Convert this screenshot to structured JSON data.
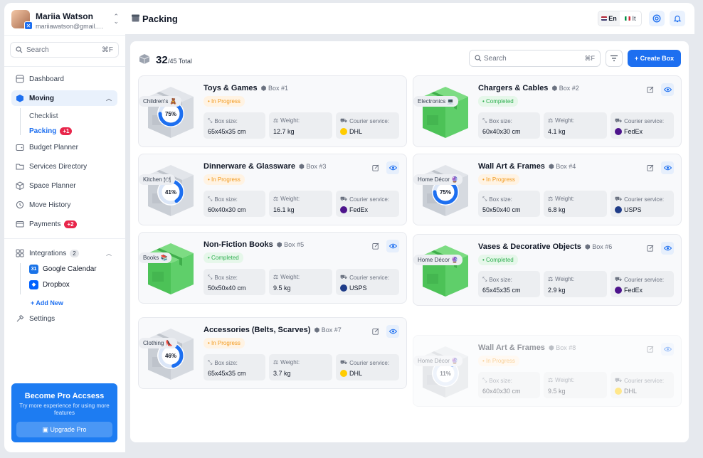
{
  "user": {
    "name": "Mariia Watson",
    "email": "mariiawatson@gmail.c..."
  },
  "sidebar": {
    "search_placeholder": "Search",
    "search_shortcut": "⌘F",
    "nav": [
      {
        "label": "Dashboard"
      },
      {
        "label": "Moving"
      },
      {
        "label": "Budget Planner"
      },
      {
        "label": "Services Directory"
      },
      {
        "label": "Space Planner"
      },
      {
        "label": "Move History"
      },
      {
        "label": "Payments",
        "badge": "+2"
      }
    ],
    "moving_sub": [
      {
        "label": "Checklist"
      },
      {
        "label": "Packing",
        "badge": "+1"
      }
    ],
    "integrations": {
      "label": "Integrations",
      "count": "2",
      "items": [
        {
          "label": "Google Calendar",
          "logo": "31",
          "color": "#1a73e8"
        },
        {
          "label": "Dropbox",
          "logo": "◆",
          "color": "#0061ff"
        }
      ],
      "add_new": "+ Add New"
    },
    "settings": "Settings",
    "pro": {
      "title": "Become Pro Accsess",
      "subtitle": "Try more experience for using more features",
      "button": "Upgrade Pro"
    }
  },
  "header": {
    "title": "Packing",
    "lang_en": "En",
    "lang_it": "It"
  },
  "toolbar": {
    "count": "32",
    "total": "/45 Total",
    "search_placeholder": "Search",
    "search_shortcut": "⌘F",
    "create_label": "+ Create Box"
  },
  "labels": {
    "box_size": "Box size:",
    "weight": "Weight:",
    "courier": "Courier service:"
  },
  "colors": {
    "accent": "#1d6ff0",
    "progress": "#f29a1e",
    "completed": "#2eaf4f",
    "box_green": "#5fcf6a",
    "box_gray": "#cfd3d9"
  },
  "boxes": [
    {
      "title": "Toys & Games",
      "num": "Box #1",
      "status": "• In Progress",
      "state": "progress",
      "category": "Children's 🧸",
      "percent": 75,
      "percent_label": "75%",
      "size": "65x45x35 cm",
      "weight": "12.7 kg",
      "courier": "DHL",
      "courier_color": "#ffcc00"
    },
    {
      "title": "Chargers & Cables",
      "num": "Box #2",
      "status": "• Completed",
      "state": "done",
      "category": "Electronics 💻",
      "percent": 100,
      "percent_label": "",
      "size": "60x40x30 cm",
      "weight": "4.1 kg",
      "courier": "FedEx",
      "courier_color": "#4d148c"
    },
    {
      "title": "Dinnerware & Glassware",
      "num": "Box #3",
      "status": "• In Progress",
      "state": "progress",
      "category": "Kitchen 🍽",
      "percent": 41,
      "percent_label": "41%",
      "size": "60x40x30 cm",
      "weight": "16.1 kg",
      "courier": "FedEx",
      "courier_color": "#4d148c"
    },
    {
      "title": "Wall Art & Frames",
      "num": "Box #4",
      "status": "• In Progress",
      "state": "progress",
      "category": "Home Décor 🔮",
      "percent": 75,
      "percent_label": "75%",
      "size": "50x50x40 cm",
      "weight": "6.8 kg",
      "courier": "USPS",
      "courier_color": "#1f3c88"
    },
    {
      "title": "Non-Fiction Books",
      "num": "Box #5",
      "status": "• Completed",
      "state": "done",
      "category": "Books 📚",
      "percent": 100,
      "percent_label": "",
      "size": "50x50x40 cm",
      "weight": "9.5 kg",
      "courier": "USPS",
      "courier_color": "#1f3c88"
    },
    {
      "title": "Vases & Decorative Objects",
      "num": "Box #6",
      "status": "• Completed",
      "state": "done",
      "category": "Home Décor 🔮",
      "percent": 100,
      "percent_label": "",
      "size": "65x45x35 cm",
      "weight": "2.9 kg",
      "courier": "FedEx",
      "courier_color": "#4d148c"
    },
    {
      "title": "Accessories (Belts, Scarves)",
      "num": "Box #7",
      "status": "• In Progress",
      "state": "progress",
      "category": "Clothing 👠",
      "percent": 46,
      "percent_label": "46%",
      "size": "65x45x35 cm",
      "weight": "3.7 kg",
      "courier": "DHL",
      "courier_color": "#ffcc00"
    },
    {
      "title": "Wall Art & Frames",
      "num": "Box #8",
      "status": "• In Progress",
      "state": "progress",
      "category": "Home Décor 🔮",
      "percent": 11,
      "percent_label": "11%",
      "size": "60x40x30 cm",
      "weight": "9.5 kg",
      "courier": "DHL",
      "courier_color": "#ffcc00",
      "faded": true
    }
  ]
}
